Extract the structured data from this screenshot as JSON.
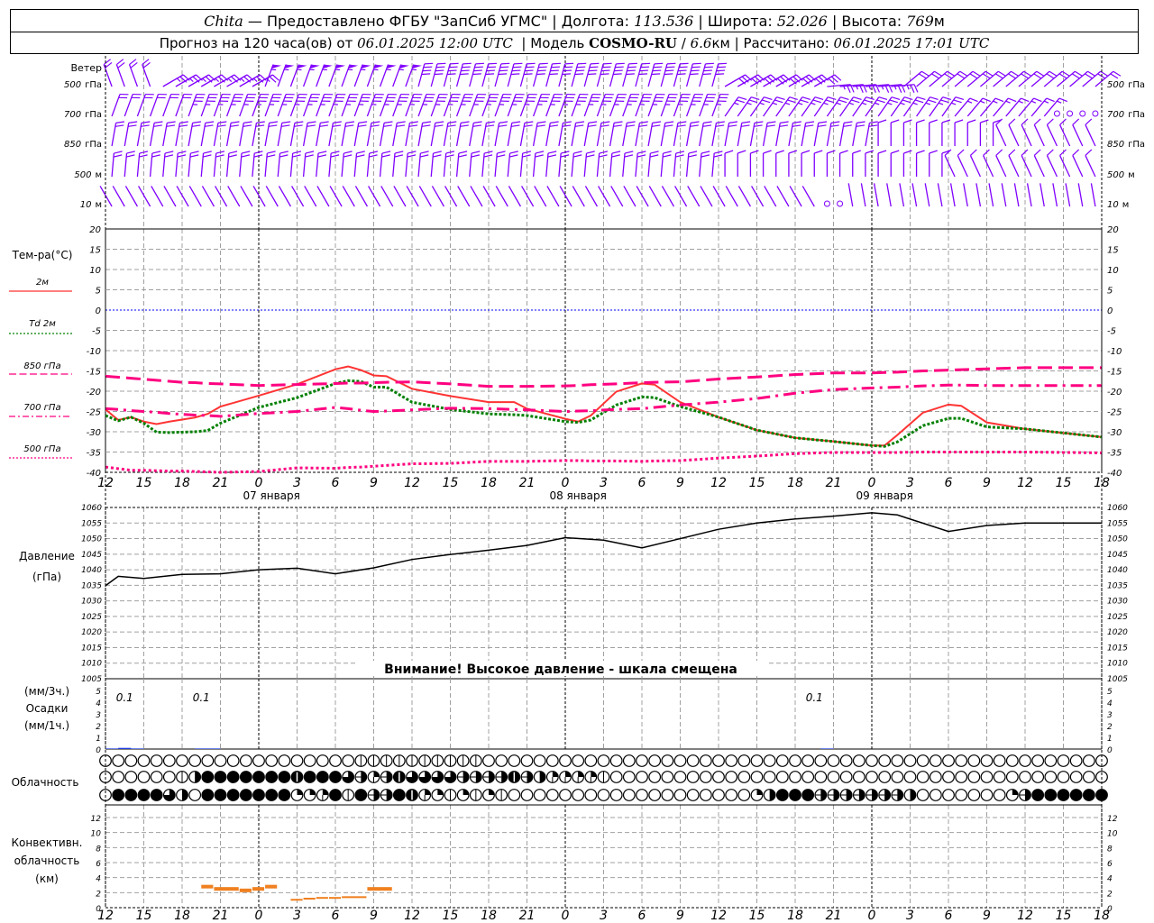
{
  "header": {
    "station": "Chita",
    "provider": " — Предоставлено ФГБУ \"ЗапСиб УГМС\" ",
    "sep": "|",
    "lon_label": " Долгота: ",
    "lon_value": "113.536",
    "lat_label": " Широта: ",
    "lat_value": "52.026",
    "alt_label": " Высота: ",
    "alt_value": "769",
    "alt_unit": "м",
    "forecast_label": "Прогноз на 120 часа(ов) от ",
    "forecast_time": "06.01.2025 12:00 UTC",
    "model_label": "  | Модель ",
    "model_name": "COSMO-RU",
    "model_sep": " / ",
    "model_res": "6.6",
    "model_res_unit": "км",
    "calc_label": " | Рассчитано: ",
    "calc_time": "06.01.2025 17:01 UTC"
  },
  "colors": {
    "wind": "#8000ff",
    "t2m": "#ff3333",
    "td2m": "#008000",
    "upper": "#ff0080",
    "zero_line": "#0000ff",
    "precip": "#2040e0",
    "convective": "#f08020"
  },
  "chart_data": [
    {
      "type": "barbs",
      "title": "Ветер",
      "levels": [
        {
          "value": "500",
          "unit": "гПа",
          "segments": [
            [
              "06.01 12:00",
              "06.01 16:00",
              340,
              20
            ],
            [
              "06.01 16:00",
              "07.01 00:00",
              60,
              25
            ],
            [
              "07.01 00:00",
              "07.01 12:00",
              20,
              55
            ],
            [
              "07.01 12:00",
              "08.01 12:00",
              15,
              40
            ],
            [
              "08.01 12:00",
              "08.01 20:00",
              60,
              30
            ],
            [
              "08.01 20:00",
              "09.01 02:00",
              85,
              25
            ],
            [
              "09.01 02:00",
              "09.01 18:00",
              50,
              20
            ]
          ]
        },
        {
          "value": "700",
          "unit": "гПа",
          "segments": [
            [
              "06.01 12:00",
              "06.01 18:00",
              20,
              20
            ],
            [
              "06.01 18:00",
              "08.01 12:00",
              20,
              35
            ],
            [
              "08.01 12:00",
              "09.01 06:00",
              35,
              25
            ],
            [
              "09.01 06:00",
              "09.01 14:00",
              40,
              15
            ],
            [
              "09.01 14:00",
              "09.01 18:00",
              0,
              0
            ]
          ]
        },
        {
          "value": "850",
          "unit": "гПа",
          "segments": [
            [
              "06.01 12:00",
              "09.01 00:00",
              10,
              20
            ],
            [
              "09.01 00:00",
              "09.01 10:00",
              0,
              10
            ],
            [
              "09.01 10:00",
              "09.01 18:00",
              335,
              10
            ]
          ]
        },
        {
          "value": "500",
          "unit": "м",
          "segments": [
            [
              "06.01 12:00",
              "08.01 12:00",
              5,
              20
            ],
            [
              "08.01 12:00",
              "09.01 06:00",
              0,
              10
            ],
            [
              "09.01 06:00",
              "09.01 18:00",
              335,
              10
            ]
          ]
        },
        {
          "value": "10",
          "unit": "м",
          "segments": [
            [
              "06.01 12:00",
              "08.01 20:00",
              330,
              2
            ],
            [
              "08.01 20:00",
              "08.01 22:00",
              0,
              0
            ],
            [
              "08.01 22:00",
              "09.01 18:00",
              350,
              2
            ]
          ]
        }
      ]
    },
    {
      "type": "line",
      "title": "Тем-ра(°C)",
      "ylim": [
        -40,
        20
      ],
      "yticks": [
        "20",
        "15",
        "10",
        "5",
        "0",
        "-5",
        "-10",
        "-15",
        "-20",
        "-25",
        "-30",
        "-35",
        "-40"
      ],
      "x_tick_labels": [
        "12",
        "15",
        "18",
        "21",
        "0",
        "3",
        "6",
        "9",
        "12",
        "15",
        "18",
        "21",
        "0",
        "3",
        "6",
        "9",
        "12",
        "15",
        "18",
        "21",
        "0",
        "3",
        "6",
        "9",
        "12",
        "15",
        "18"
      ],
      "date_labels": [
        "07 января",
        "08 января",
        "09 января"
      ],
      "x": [
        "06.01 12:00",
        "06.01 13:00",
        "06.01 14:00",
        "06.01 15:00",
        "06.01 16:00",
        "06.01 17:00",
        "06.01 18:00",
        "06.01 19:00",
        "06.01 20:00",
        "06.01 21:00",
        "07.01 00:00",
        "07.01 03:00",
        "07.01 06:00",
        "07.01 07:00",
        "07.01 08:00",
        "07.01 09:00",
        "07.01 10:00",
        "07.01 12:00",
        "07.01 15:00",
        "07.01 18:00",
        "07.01 20:00",
        "07.01 21:00",
        "08.01 00:00",
        "08.01 01:00",
        "08.01 02:00",
        "08.01 04:00",
        "08.01 06:00",
        "08.01 07:00",
        "08.01 09:00",
        "08.01 12:00",
        "08.01 15:00",
        "08.01 18:00",
        "08.01 21:00",
        "09.01 00:00",
        "09.01 01:00",
        "09.01 02:00",
        "09.01 04:00",
        "09.01 06:00",
        "09.01 07:00",
        "09.01 09:00",
        "09.01 12:00",
        "09.01 15:00",
        "09.01 18:00"
      ],
      "series": [
        {
          "name": "2м",
          "style": "solid",
          "color": "#ff3333",
          "values": [
            -24.5,
            -27.1,
            -26.4,
            -27.5,
            -28.1,
            -27.5,
            -27,
            -26.5,
            -25.6,
            -23.8,
            -21.1,
            -18.3,
            -14.6,
            -13.9,
            -14.8,
            -16.1,
            -16.3,
            -19.4,
            -21.2,
            -22.7,
            -22.7,
            -24.3,
            -26.8,
            -27.5,
            -26,
            -20.1,
            -18.1,
            -18.4,
            -22.7,
            -26.4,
            -29.6,
            -31.5,
            -32.4,
            -33.4,
            -33.4,
            -30.8,
            -25.3,
            -23.3,
            -23.6,
            -27.7,
            -29.3,
            -30.3,
            -31.3
          ]
        },
        {
          "name": "Td 2м",
          "style": "dotted",
          "color": "#008000",
          "values": [
            -26,
            -27.3,
            -26.4,
            -27.9,
            -30.1,
            -30.2,
            -30.1,
            -30,
            -29.7,
            -27.9,
            -24,
            -21.6,
            -18.1,
            -17.4,
            -17.6,
            -19,
            -19,
            -22.7,
            -24.5,
            -25.6,
            -25.8,
            -26,
            -27.5,
            -27.7,
            -27.1,
            -23.4,
            -21.4,
            -21.6,
            -23.8,
            -26.4,
            -29.6,
            -31.5,
            -32.4,
            -33.4,
            -33.6,
            -32.5,
            -28.5,
            -26.7,
            -26.7,
            -28.8,
            -29.3,
            -30.3,
            -31.3
          ]
        },
        {
          "name": "850 гПа",
          "style": "dashed",
          "color": "#ff0080",
          "values": [
            -16.3,
            -16.55,
            -16.8,
            -17.05,
            -17.3,
            -17.55,
            -17.8,
            -17.9,
            -18.1,
            -18.2,
            -18.6,
            -18.35,
            -18.1,
            -18,
            -18,
            -17.9,
            -17.8,
            -17.7,
            -18.2,
            -18.8,
            -18.8,
            -18.8,
            -18.7,
            -18.6,
            -18.4,
            -18.2,
            -17.9,
            -17.8,
            -17.7,
            -17,
            -16.5,
            -15.9,
            -15.5,
            -15.5,
            -15.4,
            -15.3,
            -15,
            -14.8,
            -14.7,
            -14.5,
            -14.2,
            -14.2,
            -14.2
          ]
        },
        {
          "name": "700 гПа",
          "style": "dash-dot",
          "color": "#ff0080",
          "values": [
            -24.3,
            -24.5,
            -24.8,
            -25,
            -25.2,
            -25.5,
            -25.7,
            -25.9,
            -26,
            -26.2,
            -25.5,
            -25,
            -24,
            -24.3,
            -24.7,
            -25,
            -24.9,
            -24.6,
            -24.2,
            -24.3,
            -24.5,
            -24.6,
            -25,
            -24.9,
            -24.8,
            -24.5,
            -24.3,
            -24,
            -23.4,
            -22.7,
            -21.8,
            -20.5,
            -19.6,
            -19.2,
            -19.1,
            -19,
            -18.7,
            -18.5,
            -18.5,
            -18.6,
            -18.6,
            -18.6,
            -18.6
          ]
        },
        {
          "name": "500 гПа",
          "style": "dotted-fine",
          "color": "#ff0080",
          "values": [
            -38.7,
            -39.1,
            -39.5,
            -39.5,
            -39.6,
            -39.7,
            -39.7,
            -39.8,
            -39.9,
            -40,
            -39.8,
            -38.9,
            -39,
            -38.8,
            -38.7,
            -38.5,
            -38.3,
            -37.9,
            -37.8,
            -37.3,
            -37.3,
            -37.3,
            -37.1,
            -37.1,
            -37.2,
            -37.2,
            -37.3,
            -37.2,
            -37.1,
            -36.5,
            -36,
            -35.4,
            -35.1,
            -35.1,
            -35.1,
            -35.1,
            -35,
            -35,
            -35,
            -35,
            -35,
            -35.1,
            -35.2
          ]
        }
      ]
    },
    {
      "type": "line",
      "title": "Давление",
      "unit": "(гПа)",
      "ylim": [
        1005,
        1060
      ],
      "yticks": [
        "1060",
        "1055",
        "1050",
        "1045",
        "1040",
        "1035",
        "1030",
        "1025",
        "1020",
        "1015",
        "1010",
        "1005"
      ],
      "note": "Внимание! Высокое давление - шкала смещена",
      "x": [
        "06.01 12:00",
        "06.01 13:00",
        "06.01 15:00",
        "06.01 18:00",
        "06.01 21:00",
        "07.01 00:00",
        "07.01 03:00",
        "07.01 06:00",
        "07.01 09:00",
        "07.01 12:00",
        "07.01 15:00",
        "07.01 18:00",
        "07.01 21:00",
        "08.01 00:00",
        "08.01 03:00",
        "08.01 06:00",
        "08.01 09:00",
        "08.01 12:00",
        "08.01 15:00",
        "08.01 18:00",
        "08.01 21:00",
        "09.01 00:00",
        "09.01 02:00",
        "09.01 06:00",
        "09.01 09:00",
        "09.01 12:00",
        "09.01 18:00"
      ],
      "values": [
        1034.9,
        1037.9,
        1037.2,
        1038.5,
        1038.7,
        1040,
        1040.5,
        1038.7,
        1040.6,
        1043.3,
        1044.9,
        1046.3,
        1047.8,
        1050.3,
        1049.5,
        1047,
        1050,
        1053,
        1055,
        1056.3,
        1057.2,
        1058.3,
        1057.6,
        1052.3,
        1054.2,
        1055,
        1055
      ]
    },
    {
      "type": "bar",
      "label_top": "(мм/3ч.)",
      "title": "Осадки",
      "label_bottom": "(мм/1ч.)",
      "ylim": [
        0,
        5
      ],
      "yticks": [
        "0",
        "1",
        "2",
        "3",
        "4",
        "5"
      ],
      "hourly": [
        [
          "06.01 12:00",
          0.05
        ],
        [
          "06.01 13:00",
          0.1
        ],
        [
          "06.01 14:00",
          0.05
        ],
        [
          "06.01 19:00",
          0.05
        ],
        [
          "06.01 20:00",
          0.05
        ],
        [
          "08.01 20:00",
          0.05
        ]
      ],
      "totals_3h": [
        [
          "06.01 12:00",
          "06.01 15:00",
          "0.1"
        ],
        [
          "06.01 18:00",
          "06.01 21:00",
          "0.1"
        ],
        [
          "08.01 18:00",
          "08.01 21:00",
          "0.1"
        ]
      ]
    },
    {
      "type": "table",
      "title": "Облачность",
      "start": "06.01 12:00",
      "step_hours": 1,
      "rows": [
        "0000000000000000000011111111110000000000000000000000000000000000000000000000000",
        "0000001488888887888653576666555575433331000000000000000000000000000000000000000",
        "0888864088888882238185587321212100000000000000000002488855555554000000025888888"
      ]
    },
    {
      "type": "bar",
      "title_lines": [
        "Конвективн.",
        "облачность",
        "(км)"
      ],
      "ylim": [
        0,
        13
      ],
      "yticks": [
        "0",
        "2",
        "4",
        "6",
        "8",
        "10",
        "12"
      ],
      "x_tick_labels": [
        "12",
        "15",
        "18",
        "21",
        "0",
        "3",
        "6",
        "9",
        "12",
        "15",
        "18",
        "21",
        "0",
        "3",
        "6",
        "9",
        "12",
        "15",
        "18",
        "21",
        "0",
        "3",
        "6",
        "9",
        "12",
        "15",
        "18"
      ],
      "bars": [
        [
          "06.01 19:30",
          "06.01 20:30",
          2.8
        ],
        [
          "06.01 20:30",
          "06.01 22:30",
          2.5
        ],
        [
          "06.01 22:30",
          "06.01 23:30",
          2.3
        ],
        [
          "06.01 23:30",
          "07.01 00:30",
          2.5
        ],
        [
          "07.01 00:30",
          "07.01 01:30",
          2.8
        ],
        [
          "07.01 02:30",
          "07.01 03:30",
          1.05
        ],
        [
          "07.01 03:30",
          "07.01 04:30",
          1.2
        ],
        [
          "07.01 04:30",
          "07.01 05:30",
          1.3
        ],
        [
          "07.01 05:30",
          "07.01 06:30",
          1.3
        ],
        [
          "07.01 06:30",
          "07.01 08:30",
          1.4
        ],
        [
          "07.01 08:30",
          "07.01 10:30",
          2.5
        ]
      ]
    }
  ]
}
